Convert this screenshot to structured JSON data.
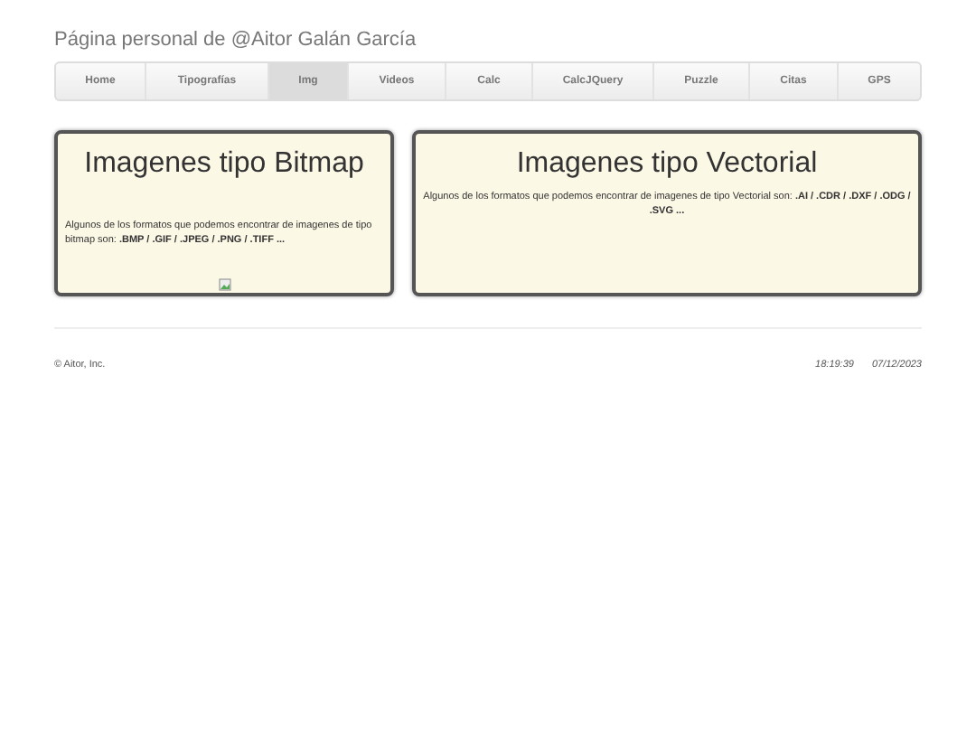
{
  "header": {
    "title": "Página personal de @Aitor Galán García"
  },
  "nav": [
    {
      "label": "Home",
      "selected": false
    },
    {
      "label": "Tipografías",
      "selected": false
    },
    {
      "label": "Img",
      "selected": true
    },
    {
      "label": "Videos",
      "selected": false
    },
    {
      "label": "Calc",
      "selected": false
    },
    {
      "label": "CalcJQuery",
      "selected": false
    },
    {
      "label": "Puzzle",
      "selected": false
    },
    {
      "label": "Citas",
      "selected": false
    },
    {
      "label": "GPS",
      "selected": false
    }
  ],
  "cards": [
    {
      "title": "Imagenes tipo Bitmap",
      "text": "Algunos de los formatos que podemos encontrar de imagenes de tipo bitmap son: **.BMP / .GIF / .JPEG / .PNG / .TIFF ...**",
      "broken_image": true
    },
    {
      "title": "Imagenes tipo Vectorial",
      "text": "Algunos de los formatos que podemos encontrar de imagenes de tipo Vectorial son: **.AI / .CDR / .DXF / .ODG / .SVG ...**",
      "broken_image": false
    }
  ],
  "footer": {
    "copyright": "© Aitor, Inc.",
    "time": "18:19:39",
    "date": "07/12/2023"
  }
}
